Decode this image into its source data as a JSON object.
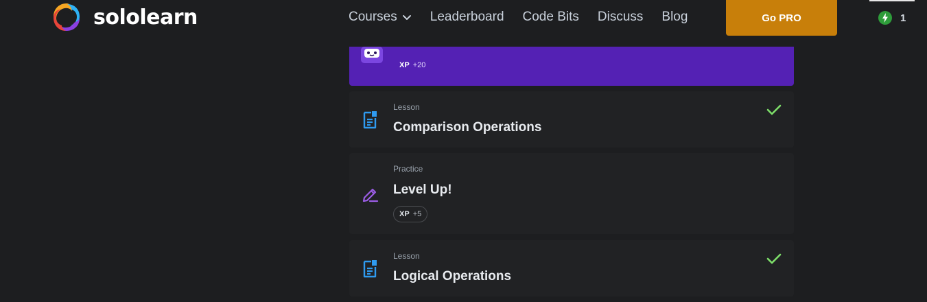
{
  "brand": {
    "name": "sololearn"
  },
  "nav": {
    "items": [
      {
        "label": "Courses",
        "has_dropdown": true
      },
      {
        "label": "Leaderboard"
      },
      {
        "label": "Code Bits"
      },
      {
        "label": "Discuss"
      },
      {
        "label": "Blog"
      }
    ],
    "cta_label": "Go PRO",
    "streak_count": "1"
  },
  "colors": {
    "background": "#1d1e20",
    "card": "#212224",
    "purple_card": "#5421b4",
    "pro_button": "#c87f0a",
    "check": "#7ee06a",
    "lesson_icon": "#2f9bf0",
    "practice_icon": "#9b5de5"
  },
  "items": [
    {
      "kind": "",
      "title": "",
      "xp_label": "XP",
      "xp_value": "+20",
      "icon": "robot-icon",
      "completed": false
    },
    {
      "kind": "Lesson",
      "title": "Comparison Operations",
      "icon": "lesson-document-icon",
      "completed": true
    },
    {
      "kind": "Practice",
      "title": "Level Up!",
      "xp_label": "XP",
      "xp_value": "+5",
      "icon": "pencil-practice-icon",
      "completed": false
    },
    {
      "kind": "Lesson",
      "title": "Logical Operations",
      "icon": "lesson-document-icon",
      "completed": true
    }
  ]
}
